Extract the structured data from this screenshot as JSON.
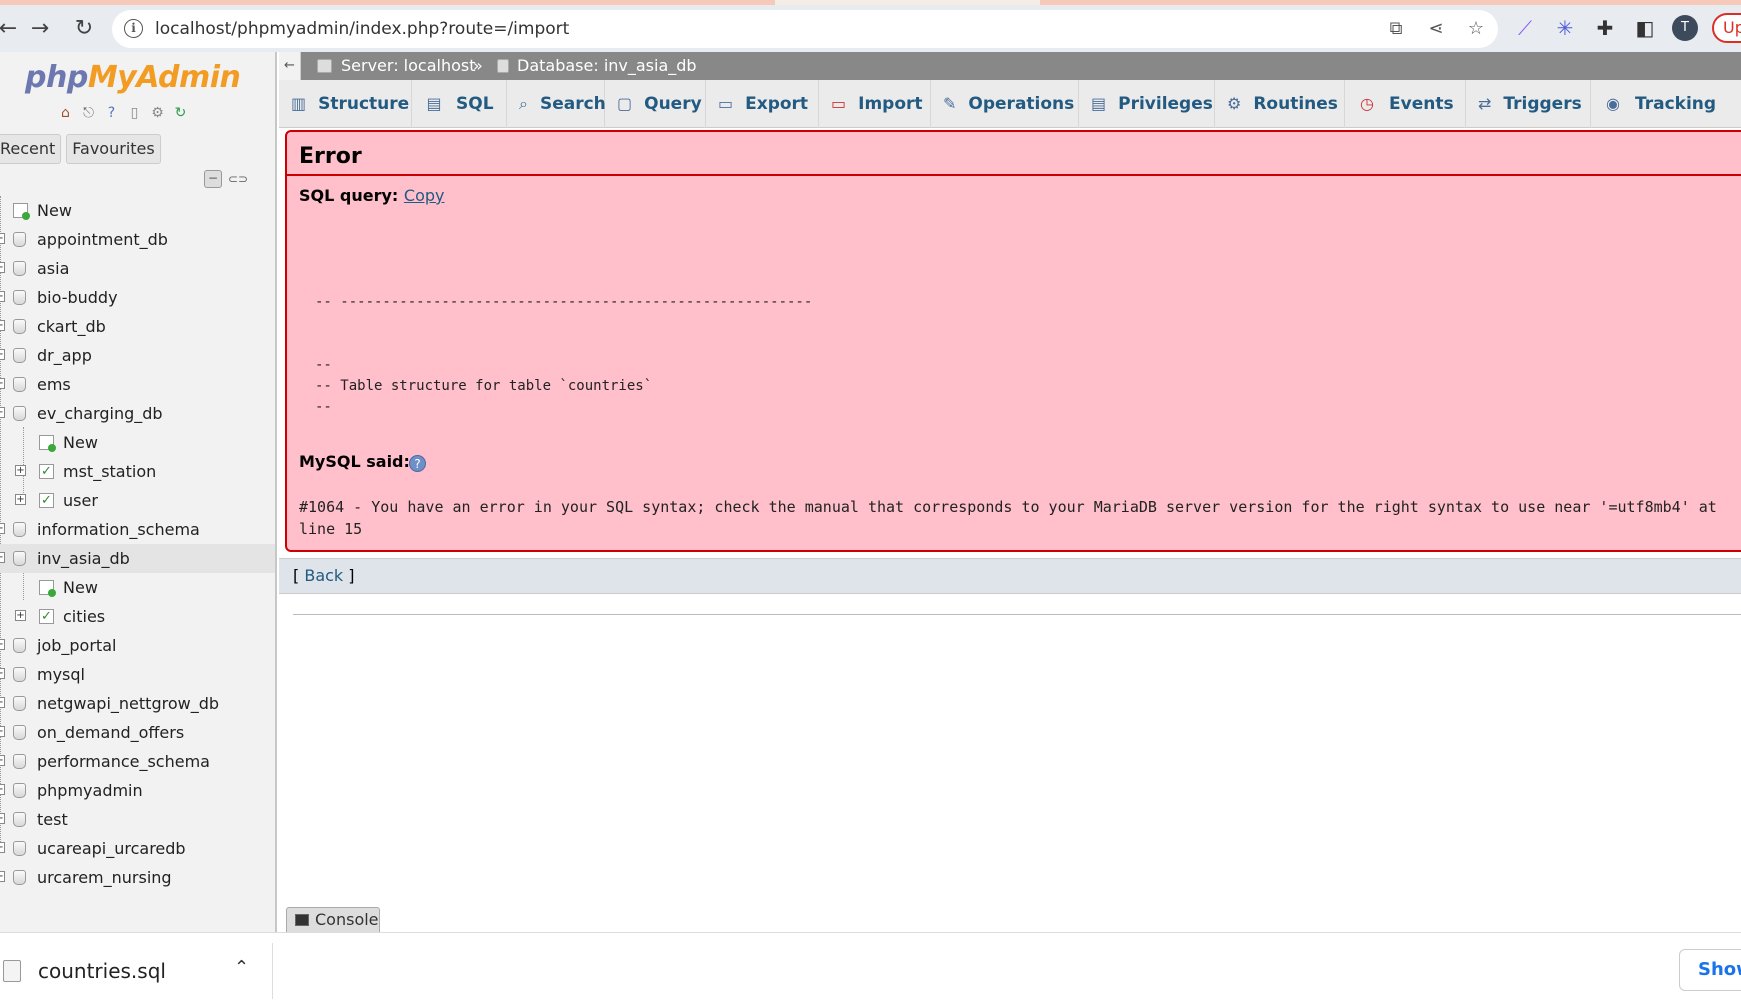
{
  "browser": {
    "url": "localhost/phpmyadmin/index.php?route=/import",
    "profile_initial": "T",
    "update_label": "Up"
  },
  "leftnav": {
    "logo_php": "php",
    "logo_myadmin": "MyAdmin",
    "tabs": [
      "Recent",
      "Favourites"
    ],
    "tree": [
      {
        "label": "New"
      },
      {
        "label": "appointment_db"
      },
      {
        "label": "asia"
      },
      {
        "label": "bio-buddy"
      },
      {
        "label": "ckart_db"
      },
      {
        "label": "dr_app"
      },
      {
        "label": "ems"
      },
      {
        "label": "ev_charging_db"
      },
      {
        "label": "New"
      },
      {
        "label": "mst_station"
      },
      {
        "label": "user"
      },
      {
        "label": "information_schema"
      },
      {
        "label": "inv_asia_db"
      },
      {
        "label": "New"
      },
      {
        "label": "cities"
      },
      {
        "label": "job_portal"
      },
      {
        "label": "mysql"
      },
      {
        "label": "netgwapi_nettgrow_db"
      },
      {
        "label": "on_demand_offers"
      },
      {
        "label": "performance_schema"
      },
      {
        "label": "phpmyadmin"
      },
      {
        "label": "test"
      },
      {
        "label": "ucareapi_urcaredb"
      },
      {
        "label": "urcarem_nursing"
      }
    ]
  },
  "breadcrumb": {
    "server": "Server: localhost",
    "sep": "»",
    "database": "Database: inv_asia_db"
  },
  "tabs": [
    "Structure",
    "SQL",
    "Search",
    "Query",
    "Export",
    "Import",
    "Operations",
    "Privileges",
    "Routines",
    "Events",
    "Triggers",
    "Tracking"
  ],
  "error": {
    "title": "Error",
    "sql_query_label": "SQL query:",
    "copy_link": "Copy",
    "sql_text": "-- --------------------------------------------------------\n\n\n--\n-- Table structure for table `countries`\n--",
    "mysql_said_label": "MySQL said:",
    "message": "#1064 - You have an error in your SQL syntax; check the manual that corresponds to your MariaDB server version for the right syntax to use near '=utf8mb4' at line 15"
  },
  "back": {
    "open": "[",
    "label": "Back",
    "close": "]"
  },
  "console_label": "Console",
  "download": {
    "filename": "countries.sql",
    "show_all": "Show"
  }
}
